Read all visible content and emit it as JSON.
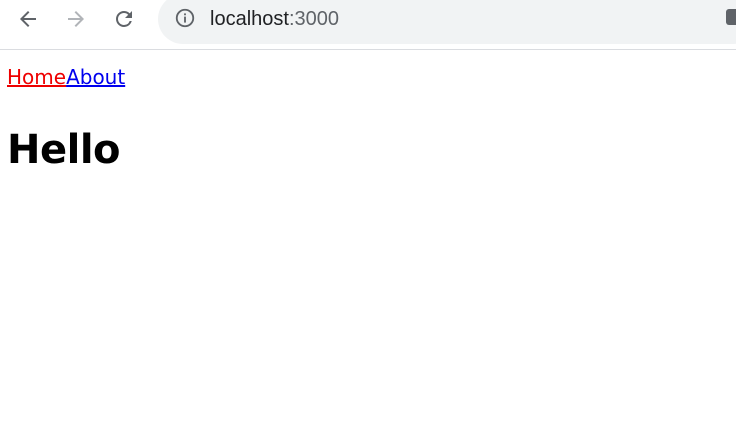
{
  "browser": {
    "back_icon": "arrow-left-icon",
    "forward_icon": "arrow-right-icon",
    "reload_icon": "reload-icon",
    "site_info_icon": "info-icon",
    "url_host": "localhost",
    "url_port": ":3000"
  },
  "page": {
    "nav": {
      "home_label": "Home",
      "about_label": "About"
    },
    "heading": "Hello"
  },
  "colors": {
    "link_active": "#ee0000",
    "link_default": "#0000ee",
    "omnibox_bg": "#f1f3f4"
  }
}
